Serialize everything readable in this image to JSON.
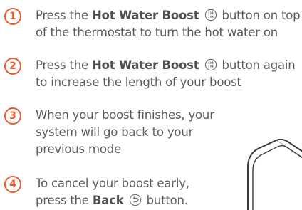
{
  "steps": [
    {
      "number": "1",
      "pre": "Press the ",
      "button_name": "Hot Water Boost",
      "icon": "hot-water-boost-icon",
      "line1_post": " button on top",
      "line2": "of the thermostat to turn the hot water on"
    },
    {
      "number": "2",
      "pre": "Press the ",
      "button_name": "Hot Water Boost",
      "icon": "hot-water-boost-icon",
      "line1_post": " button again",
      "line2": "to increase the length of your boost"
    },
    {
      "number": "3",
      "line1": "When your boost finishes, your",
      "line2": "system will go back to your",
      "line3": "previous mode"
    },
    {
      "number": "4",
      "line1": "To cancel your boost early,",
      "pre": "press the ",
      "button_name": "Back",
      "icon": "back-icon",
      "line2_post": " button."
    }
  ],
  "colors": {
    "accent": "#f05a28",
    "text": "#5b5b5b"
  }
}
